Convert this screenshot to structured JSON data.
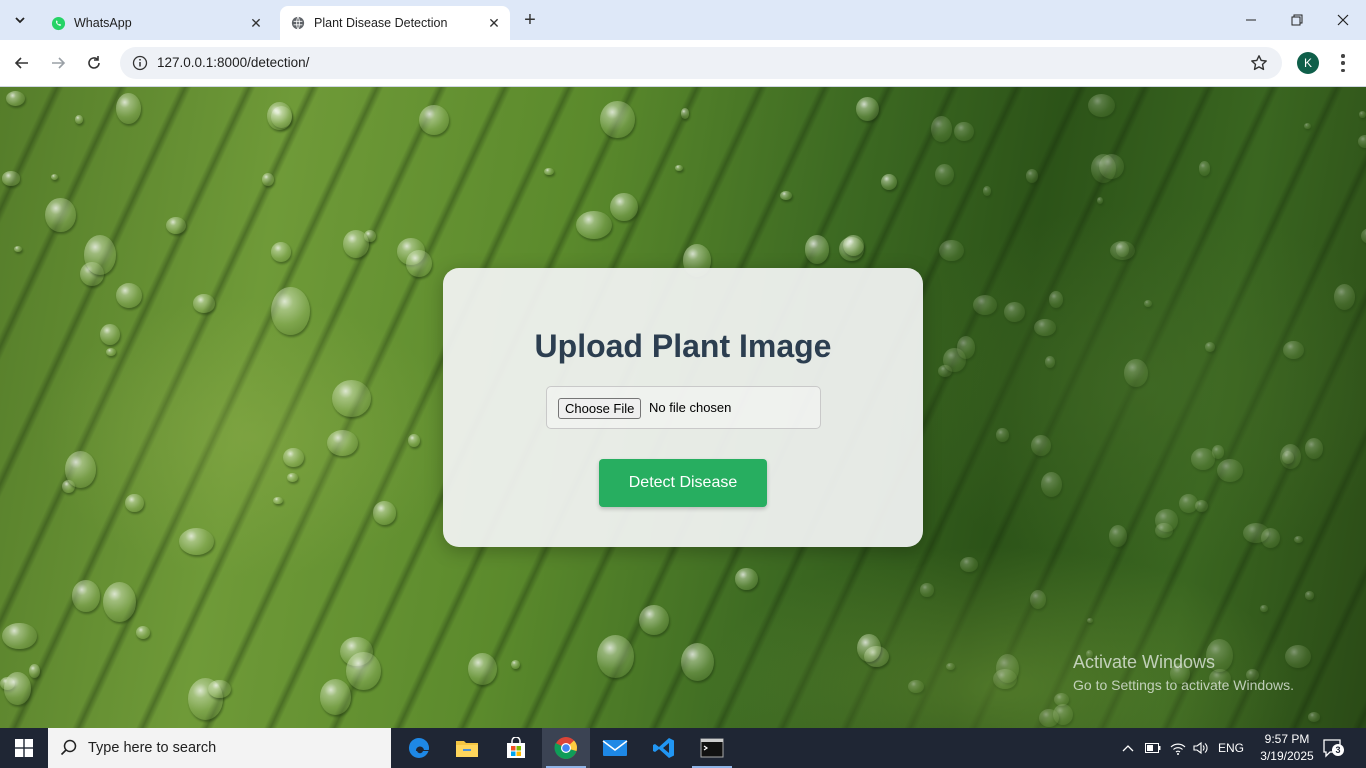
{
  "browser": {
    "tabs": [
      {
        "title": "WhatsApp",
        "icon": "whatsapp-icon",
        "active": false
      },
      {
        "title": "Plant Disease Detection",
        "icon": "globe-icon",
        "active": true
      }
    ],
    "url": "127.0.0.1:8000/detection/",
    "profile_initial": "K",
    "accent": "#dee8f8"
  },
  "page": {
    "heading": "Upload Plant Image",
    "file_input": {
      "button_label": "Choose File",
      "status": "No file chosen"
    },
    "submit_label": "Detect Disease",
    "submit_color": "#27ae60",
    "heading_color": "#2c3e50"
  },
  "watermark": {
    "line1": "Activate Windows",
    "line2": "Go to Settings to activate Windows."
  },
  "taskbar": {
    "search_placeholder": "Type here to search",
    "apps": [
      "edge-icon",
      "file-explorer-icon",
      "store-icon",
      "chrome-icon",
      "mail-icon",
      "vscode-icon",
      "terminal-icon"
    ],
    "active_app": "chrome-icon",
    "language": "ENG",
    "time": "9:57 PM",
    "date": "3/19/2025",
    "notification_count": "3"
  }
}
